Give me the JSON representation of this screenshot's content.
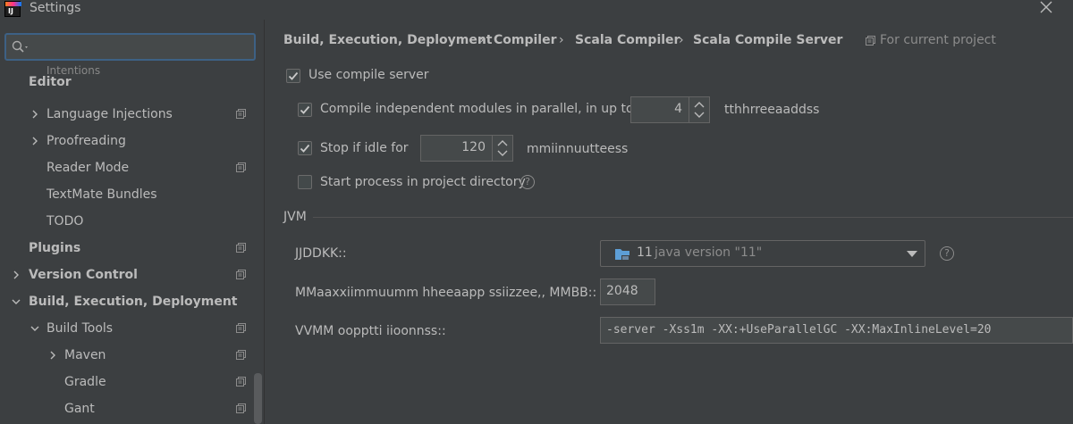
{
  "window": {
    "title": "Settings"
  },
  "search": {
    "placeholder": ""
  },
  "sidebar": {
    "partial_item": "Intentions",
    "items": [
      {
        "label": "Editor"
      },
      {
        "label": "Language Injections"
      },
      {
        "label": "Proofreading"
      },
      {
        "label": "Reader Mode"
      },
      {
        "label": "TextMate Bundles"
      },
      {
        "label": "TODO"
      },
      {
        "label": "Plugins"
      },
      {
        "label": "Version Control"
      },
      {
        "label": "Build, Execution, Deployment"
      },
      {
        "label": "Build Tools"
      },
      {
        "label": "Maven"
      },
      {
        "label": "Gradle"
      },
      {
        "label": "Gant"
      }
    ]
  },
  "breadcrumb": {
    "items": [
      "Build, Execution, Deployment",
      "Compiler",
      "Scala Compiler",
      "Scala Compile Server"
    ],
    "separator": "›",
    "scope": "For current project"
  },
  "options": {
    "use_compile_server": {
      "label": "Use compile server",
      "checked": true
    },
    "parallel": {
      "label": "Compile independent modules in parallel, in up to",
      "checked": true,
      "value": "4",
      "unit": "tthhrreeaaddss"
    },
    "idle": {
      "label": "Stop if idle for",
      "checked": true,
      "value": "120",
      "unit": "mmiinnuutteess"
    },
    "project_dir": {
      "label": "Start process in project directory",
      "checked": false
    }
  },
  "jvm": {
    "section_title": "JVM",
    "jdk_label": "JJDDKK::",
    "jdk_number": "11",
    "jdk_version": "java version \"11\"",
    "heap_label": "MMaaxxiimmuumm  hheeaapp  ssiizzee,,  MMBB::",
    "heap_value": "2048",
    "vm_options_label": "VVMM  oopptti iioonnss::",
    "vm_options_value": "-server -Xss1m -XX:+UseParallelGC -XX:MaxInlineLevel=20"
  },
  "colors": {
    "background": "#3c3f41",
    "checkbox_check": "#c9c9c9",
    "focus_border": "#3d6185",
    "folder_icon": "#5d9ed6"
  }
}
